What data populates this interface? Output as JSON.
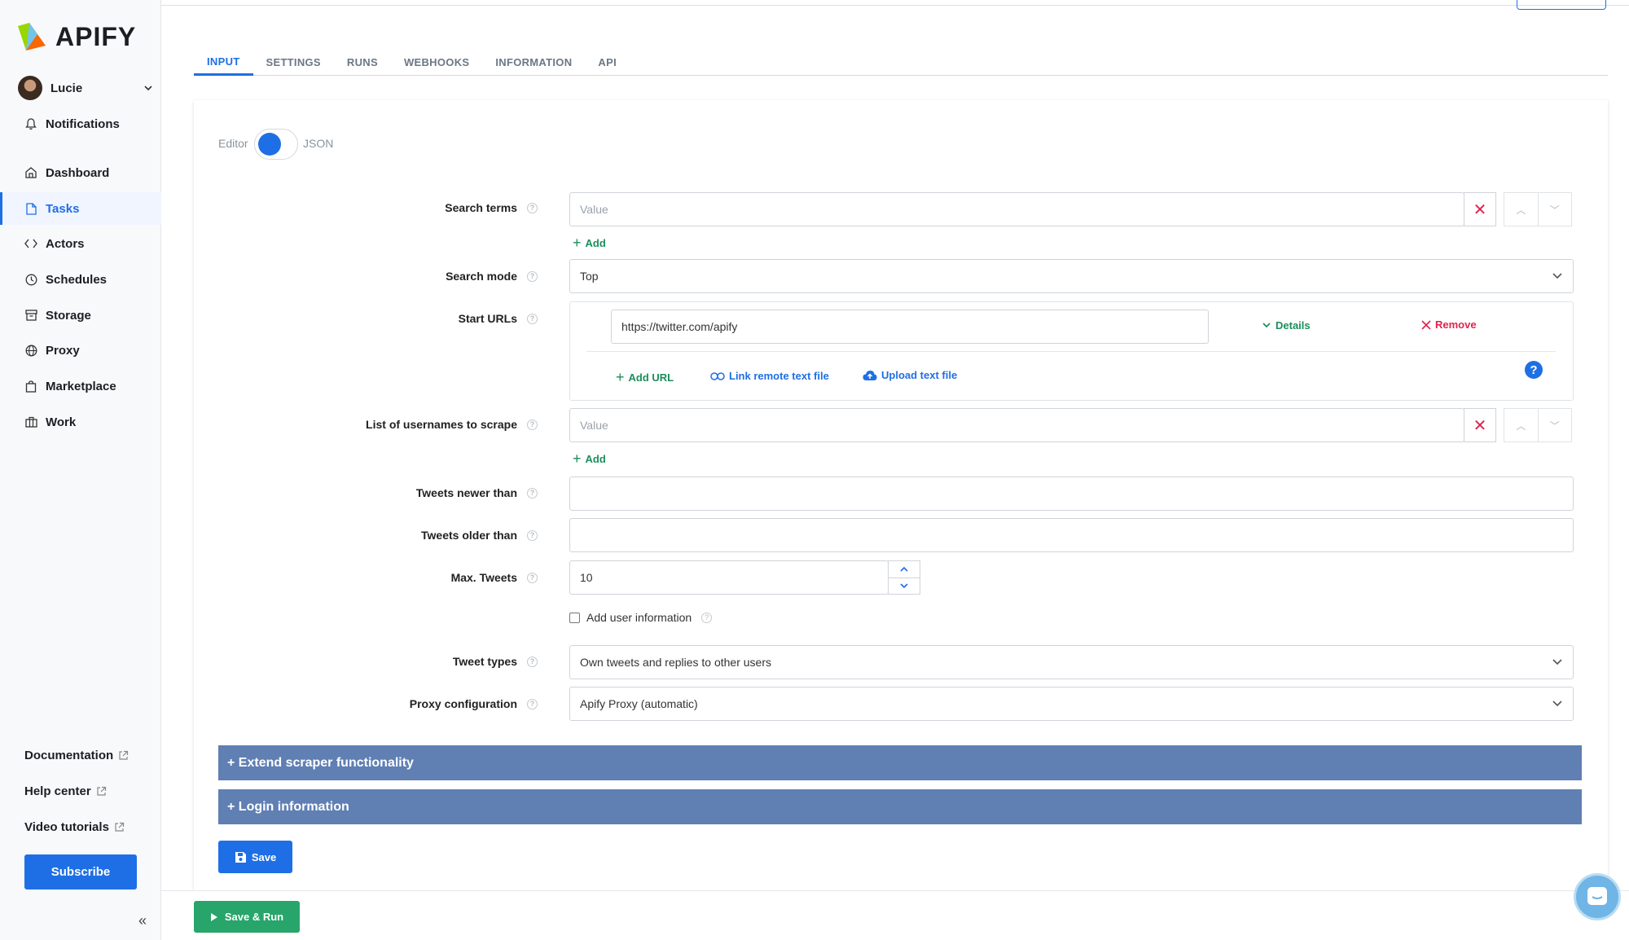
{
  "brand": {
    "name": "APIFY"
  },
  "user": {
    "name": "Lucie"
  },
  "nav": {
    "notifications": "Notifications",
    "items": [
      {
        "label": "Dashboard",
        "icon": "home-icon"
      },
      {
        "label": "Tasks",
        "icon": "file-icon",
        "active": true
      },
      {
        "label": "Actors",
        "icon": "code-icon"
      },
      {
        "label": "Schedules",
        "icon": "clock-icon"
      },
      {
        "label": "Storage",
        "icon": "archive-icon"
      },
      {
        "label": "Proxy",
        "icon": "globe-icon"
      },
      {
        "label": "Marketplace",
        "icon": "store-icon"
      },
      {
        "label": "Work",
        "icon": "briefcase-icon"
      }
    ],
    "bottom": {
      "documentation": "Documentation",
      "help_center": "Help center",
      "video_tutorials": "Video tutorials",
      "subscribe": "Subscribe"
    }
  },
  "tabs": [
    "INPUT",
    "SETTINGS",
    "RUNS",
    "WEBHOOKS",
    "INFORMATION",
    "API"
  ],
  "editor_toggle": {
    "left": "Editor",
    "right": "JSON"
  },
  "form": {
    "search_terms": {
      "label": "Search terms",
      "placeholder": "Value",
      "add": "Add"
    },
    "search_mode": {
      "label": "Search mode",
      "value": "Top"
    },
    "start_urls": {
      "label": "Start URLs",
      "url": "https://twitter.com/apify",
      "details": "Details",
      "remove": "Remove",
      "add_url": "Add URL",
      "link_remote": "Link remote text file",
      "upload": "Upload text file"
    },
    "usernames": {
      "label": "List of usernames to scrape",
      "placeholder": "Value",
      "add": "Add"
    },
    "tweets_newer": {
      "label": "Tweets newer than",
      "value": ""
    },
    "tweets_older": {
      "label": "Tweets older than",
      "value": ""
    },
    "max_tweets": {
      "label": "Max. Tweets",
      "value": "10"
    },
    "add_user_info": {
      "label": "Add user information",
      "checked": false
    },
    "tweet_types": {
      "label": "Tweet types",
      "value": "Own tweets and replies to other users"
    },
    "proxy": {
      "label": "Proxy configuration",
      "value": "Apify Proxy (automatic)"
    }
  },
  "sections": {
    "extend": "+ Extend scraper functionality",
    "login": "+ Login information"
  },
  "buttons": {
    "save": "Save",
    "save_run": "Save & Run"
  },
  "colors": {
    "accent": "#1e6fe6",
    "green": "#27a56b",
    "section": "#607fb3",
    "danger": "#e0234e"
  }
}
